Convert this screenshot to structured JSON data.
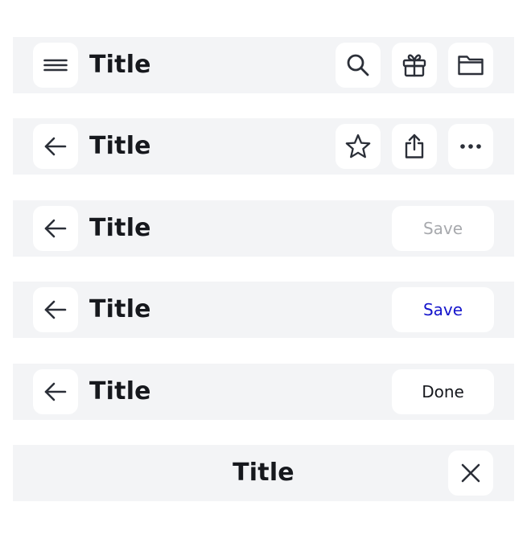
{
  "colors": {
    "bar_background": "#f3f4f6",
    "button_background": "#ffffff",
    "icon": "#2b2f38",
    "title_text": "#16181d",
    "save_disabled": "#a7a9ad",
    "save_active": "#1414cc",
    "done_text": "#16181d"
  },
  "bars": [
    {
      "title": "Title",
      "leading_icon": "menu-icon",
      "trailing_icons": [
        "search-icon",
        "gift-icon",
        "folder-icon"
      ]
    },
    {
      "title": "Title",
      "leading_icon": "arrow-left-icon",
      "trailing_icons": [
        "star-icon",
        "share-icon",
        "more-horizontal-icon"
      ]
    },
    {
      "title": "Title",
      "leading_icon": "arrow-left-icon",
      "action_label": "Save",
      "action_state": "disabled"
    },
    {
      "title": "Title",
      "leading_icon": "arrow-left-icon",
      "action_label": "Save",
      "action_state": "active"
    },
    {
      "title": "Title",
      "leading_icon": "arrow-left-icon",
      "action_label": "Done",
      "action_state": "default"
    },
    {
      "title": "Title",
      "title_alignment": "center",
      "trailing_icons": [
        "close-icon"
      ]
    }
  ]
}
